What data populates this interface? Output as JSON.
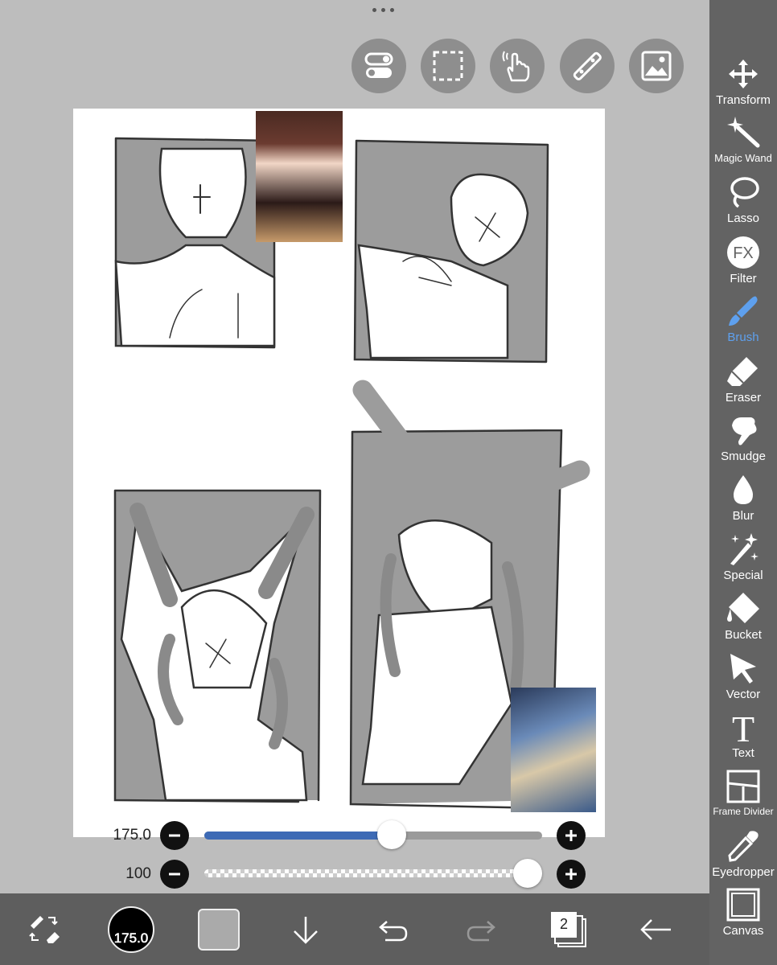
{
  "top_toolbar": {
    "buttons": [
      {
        "icon": "toggle-settings-icon"
      },
      {
        "icon": "selection-icon"
      },
      {
        "icon": "hand-gesture-icon"
      },
      {
        "icon": "ruler-icon"
      },
      {
        "icon": "image-icon"
      }
    ]
  },
  "right_toolbar": {
    "tools": [
      {
        "label": "Transform",
        "icon": "move-arrows-icon"
      },
      {
        "label": "Magic Wand",
        "icon": "magic-wand-icon"
      },
      {
        "label": "Lasso",
        "icon": "lasso-icon"
      },
      {
        "label": "Filter",
        "icon": "fx-icon",
        "glyph": "FX"
      },
      {
        "label": "Brush",
        "icon": "brush-icon",
        "active": true
      },
      {
        "label": "Eraser",
        "icon": "eraser-icon"
      },
      {
        "label": "Smudge",
        "icon": "smudge-icon"
      },
      {
        "label": "Blur",
        "icon": "drop-icon"
      },
      {
        "label": "Special",
        "icon": "special-sparkle-icon"
      },
      {
        "label": "Bucket",
        "icon": "bucket-icon"
      },
      {
        "label": "Vector",
        "icon": "cursor-arrow-icon"
      },
      {
        "label": "Text",
        "icon": "text-icon",
        "glyph": "T"
      },
      {
        "label": "Frame Divider",
        "icon": "frame-divider-icon"
      },
      {
        "label": "Eyedropper",
        "icon": "eyedropper-icon"
      },
      {
        "label": "Canvas",
        "icon": "canvas-icon"
      }
    ],
    "active_color": "#5ea0ee"
  },
  "sliders": {
    "size": {
      "value": "175.0",
      "level": 0.56,
      "fill_color": "#3d6ab5"
    },
    "opacity": {
      "value": "100",
      "level": 1.0
    }
  },
  "bottom_toolbar": {
    "brush_size_label": "175.0",
    "primary_color": "#aaaaaa",
    "layers_count": "2",
    "items": [
      "swap-tools-icon",
      "brush-size-indicator",
      "color-swatch",
      "download-arrow-icon",
      "undo-icon",
      "redo-icon",
      "layers-icon",
      "back-arrow-icon"
    ]
  }
}
